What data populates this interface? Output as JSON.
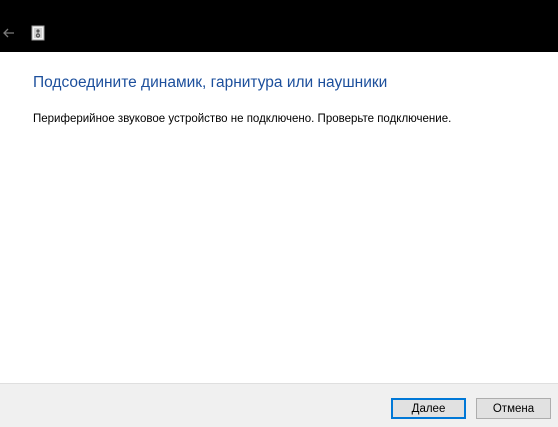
{
  "titlebar": {
    "back_icon": "arrow-left-icon",
    "app_icon": "speaker-device-icon"
  },
  "main": {
    "heading": "Подсоедините динамик, гарнитура или наушники",
    "message": "Периферийное звуковое устройство не подключено. Проверьте подключение."
  },
  "footer": {
    "next_label": "Далее",
    "cancel_label": "Отмена"
  },
  "colors": {
    "heading": "#1c4f9c",
    "titlebar_bg": "#000000",
    "footer_bg": "#f0f0f0",
    "default_button_border": "#0078d7"
  }
}
